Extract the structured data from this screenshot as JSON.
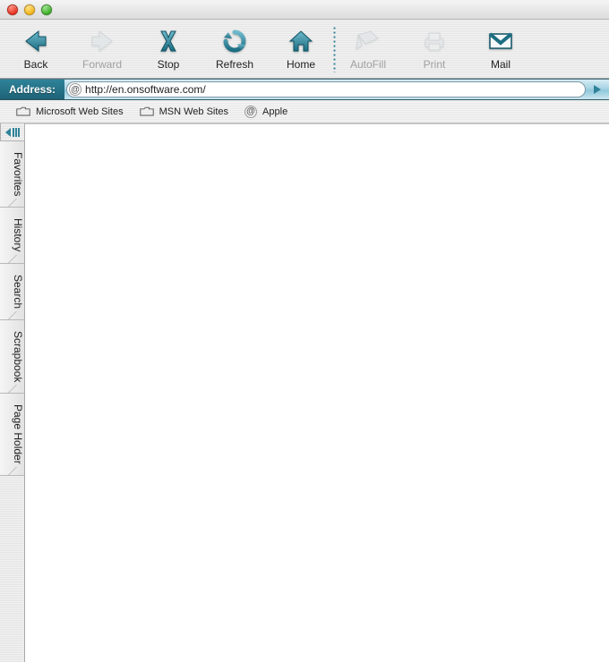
{
  "toolbar": {
    "back": "Back",
    "forward": "Forward",
    "stop": "Stop",
    "refresh": "Refresh",
    "home": "Home",
    "autofill": "AutoFill",
    "print": "Print",
    "mail": "Mail"
  },
  "address": {
    "label": "Address:",
    "url": "http://en.onsoftware.com/"
  },
  "favorites_bar": {
    "items": [
      {
        "label": "Microsoft Web Sites"
      },
      {
        "label": "MSN Web Sites"
      },
      {
        "label": "Apple"
      }
    ]
  },
  "side_tabs": {
    "items": [
      {
        "label": "Favorites"
      },
      {
        "label": "History"
      },
      {
        "label": "Search"
      },
      {
        "label": "Scrapbook"
      },
      {
        "label": "Page Holder"
      }
    ]
  },
  "colors": {
    "accent_dark": "#1e6276",
    "accent_mid": "#2f8399",
    "accent_light": "#8fc8dc"
  }
}
